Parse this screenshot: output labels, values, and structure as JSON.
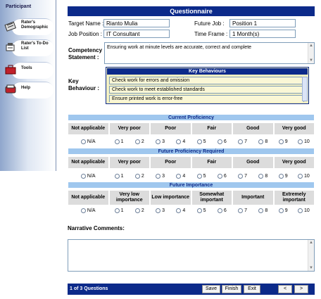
{
  "sidebar": {
    "heading": "Participant",
    "items": [
      {
        "label": "Rater's Demographic",
        "icon": "demographic-icon"
      },
      {
        "label": "Rater's To-Do List",
        "icon": "todo-icon"
      },
      {
        "label": "Tools",
        "icon": "tools-icon"
      },
      {
        "label": "Help",
        "icon": "help-icon"
      }
    ]
  },
  "header": {
    "title": "Questionnaire"
  },
  "form": {
    "target_name_label": "Target Name :",
    "target_name_value": "Rianto Mulia",
    "future_job_label": "Future Job :",
    "future_job_value": "Position 1",
    "job_position_label": "Job Position :",
    "job_position_value": "IT Consultant",
    "time_frame_label": "Time Frame :",
    "time_frame_value": "1 Month(s)",
    "competency_label": "Competency Statement :",
    "competency_value": "Ensuring work at minute levels are accurate, correct and complete",
    "key_behaviour_label": "Key Behaviour :"
  },
  "key_behaviours": {
    "title": "Key Behaviours",
    "items": [
      "Check work for errors and omission",
      "Check work to meet established standards",
      "Ensure printed work is error-free"
    ]
  },
  "sections": [
    {
      "title": "Current Proficiency",
      "headers": [
        "Not applicable",
        "Very poor",
        "Poor",
        "Fair",
        "Good",
        "Very good"
      ]
    },
    {
      "title": "Future Proficiency Required",
      "headers": [
        "Not applicable",
        "Very poor",
        "Poor",
        "Fair",
        "Good",
        "Very good"
      ]
    },
    {
      "title": "Future Importance",
      "headers": [
        "Not applicable",
        "Very low importance",
        "Low importance",
        "Somewhat important",
        "Important",
        "Extremely important"
      ]
    }
  ],
  "options": [
    "N/A",
    "1",
    "2",
    "3",
    "4",
    "5",
    "6",
    "7",
    "8",
    "9",
    "10"
  ],
  "narrative": {
    "label": "Narrative Comments:",
    "value": ""
  },
  "footer": {
    "status": "1 of 3 Questions",
    "save": "Save",
    "finish": "Finish",
    "exit": "Exit",
    "prev": "<",
    "next": ">"
  },
  "colors": {
    "navy": "#0c2a8a",
    "section_blue": "#9fc7ee",
    "key_behaviour_bg": "#f3f0c2"
  }
}
